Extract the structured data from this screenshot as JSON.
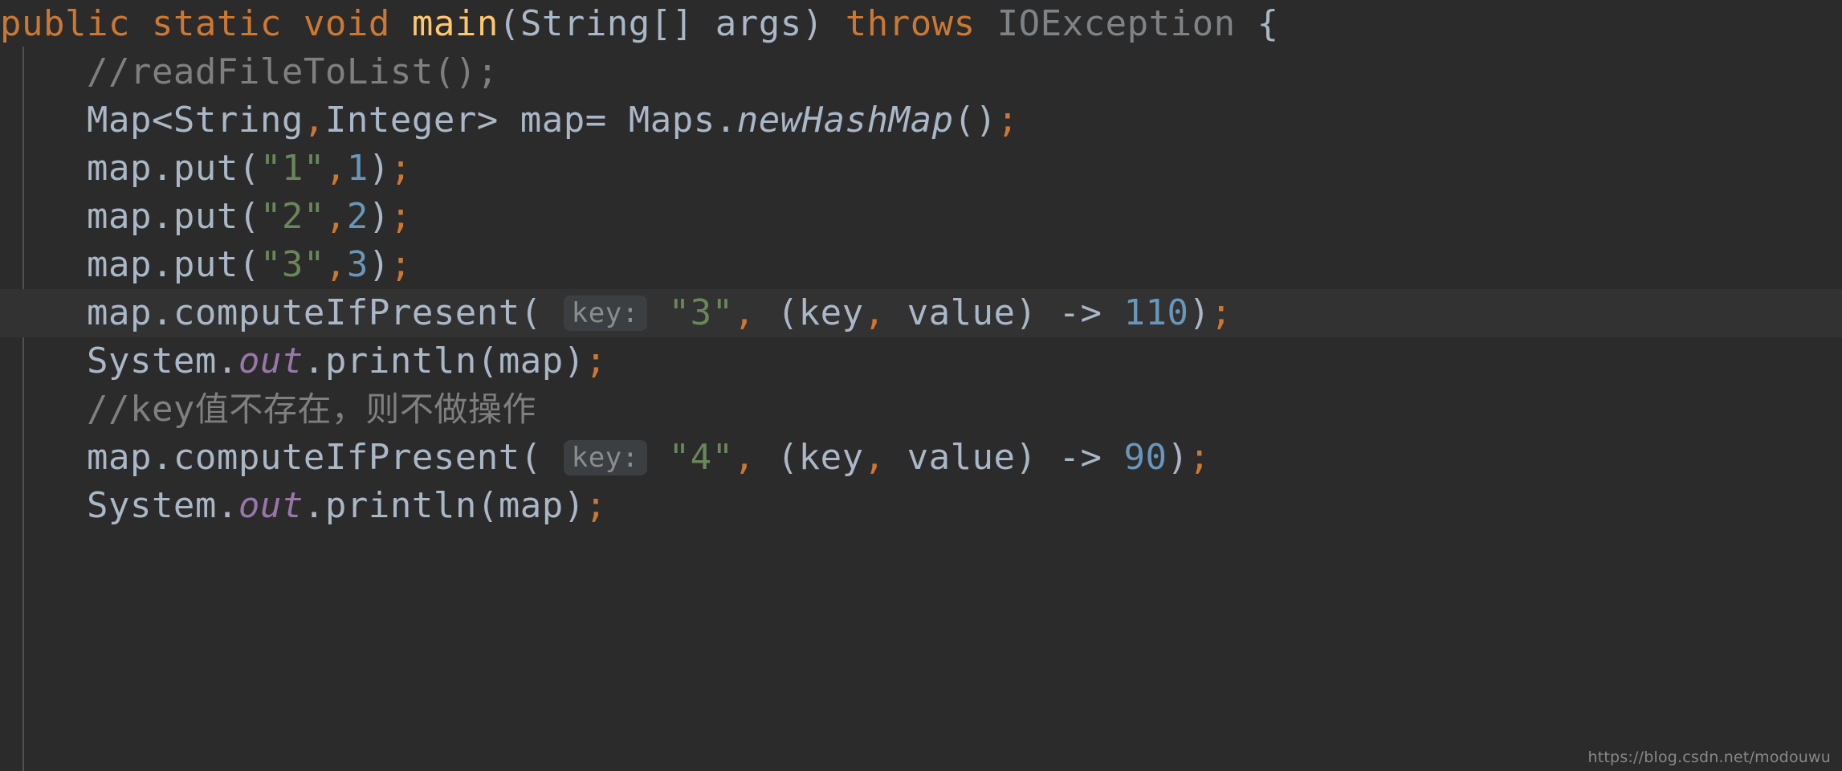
{
  "editor": {
    "theme_name": "Darcula",
    "language": "Java",
    "background_color": "#2b2b2b",
    "caret_line_color": "#323232",
    "guide_line_color": "#4f5050",
    "font_size_px": 44,
    "line_height_px": 60,
    "colors": {
      "keyword": "#cc7832",
      "method_declaration": "#ffc66d",
      "identifier": "#a9b7c6",
      "dimmed_type": "#7f8386",
      "string": "#6a8759",
      "number": "#6897bb",
      "comment": "#7f7f7f",
      "static_field": "#9876aa",
      "param_hint_bg": "#3c3f41",
      "param_hint_fg": "#8c8c8c"
    }
  },
  "lines": [
    {
      "index": 1,
      "indent": 0,
      "caret": false,
      "plain": "public static void main(String[] args) throws IOException {",
      "tokens": [
        {
          "text": "public",
          "type": "keyword"
        },
        {
          "text": " ",
          "type": "plain"
        },
        {
          "text": "static",
          "type": "keyword"
        },
        {
          "text": " ",
          "type": "plain"
        },
        {
          "text": "void",
          "type": "keyword"
        },
        {
          "text": " ",
          "type": "plain"
        },
        {
          "text": "main",
          "type": "method"
        },
        {
          "text": "(",
          "type": "punct"
        },
        {
          "text": "String",
          "type": "ident"
        },
        {
          "text": "[] args) ",
          "type": "ident"
        },
        {
          "text": "throws",
          "type": "keyword"
        },
        {
          "text": " ",
          "type": "plain"
        },
        {
          "text": "IOException",
          "type": "dim"
        },
        {
          "text": " {",
          "type": "punct"
        }
      ]
    },
    {
      "index": 2,
      "indent": 1,
      "caret": false,
      "plain": "//readFileToList();",
      "tokens": [
        {
          "text": "//readFileToList();",
          "type": "comment"
        }
      ]
    },
    {
      "index": 3,
      "indent": 1,
      "caret": false,
      "plain": "Map<String,Integer> map= Maps.newHashMap();",
      "tokens": [
        {
          "text": "Map<String",
          "type": "ident"
        },
        {
          "text": ",",
          "type": "comma"
        },
        {
          "text": "Integer> map= Maps",
          "type": "ident"
        },
        {
          "text": ".",
          "type": "punct"
        },
        {
          "text": "newHashMap",
          "type": "italic"
        },
        {
          "text": "()",
          "type": "punct"
        },
        {
          "text": ";",
          "type": "semi"
        }
      ]
    },
    {
      "index": 4,
      "indent": 1,
      "caret": false,
      "plain": "map.put(\"1\",1);",
      "tokens": [
        {
          "text": "map.put(",
          "type": "ident"
        },
        {
          "text": "\"1\"",
          "type": "string"
        },
        {
          "text": ",",
          "type": "comma"
        },
        {
          "text": "1",
          "type": "number"
        },
        {
          "text": ")",
          "type": "punct"
        },
        {
          "text": ";",
          "type": "semi"
        }
      ]
    },
    {
      "index": 5,
      "indent": 1,
      "caret": false,
      "plain": "map.put(\"2\",2);",
      "tokens": [
        {
          "text": "map.put(",
          "type": "ident"
        },
        {
          "text": "\"2\"",
          "type": "string"
        },
        {
          "text": ",",
          "type": "comma"
        },
        {
          "text": "2",
          "type": "number"
        },
        {
          "text": ")",
          "type": "punct"
        },
        {
          "text": ";",
          "type": "semi"
        }
      ]
    },
    {
      "index": 6,
      "indent": 1,
      "caret": false,
      "plain": "map.put(\"3\",3);",
      "tokens": [
        {
          "text": "map.put(",
          "type": "ident"
        },
        {
          "text": "\"3\"",
          "type": "string"
        },
        {
          "text": ",",
          "type": "comma"
        },
        {
          "text": "3",
          "type": "number"
        },
        {
          "text": ")",
          "type": "punct"
        },
        {
          "text": ";",
          "type": "semi"
        }
      ]
    },
    {
      "index": 7,
      "indent": 1,
      "caret": true,
      "plain": "map.computeIfPresent( key: \"3\", (key, value) -> 110);",
      "hint": "key:",
      "tokens": [
        {
          "text": "map.computeIfPresent(",
          "type": "ident"
        },
        {
          "text": " ",
          "type": "plain"
        },
        {
          "text": "key:",
          "type": "hint"
        },
        {
          "text": " ",
          "type": "plain"
        },
        {
          "text": "\"3\"",
          "type": "string"
        },
        {
          "text": ",",
          "type": "comma"
        },
        {
          "text": " (key",
          "type": "ident"
        },
        {
          "text": ",",
          "type": "comma"
        },
        {
          "text": " value) -> ",
          "type": "ident"
        },
        {
          "text": "110",
          "type": "number"
        },
        {
          "text": ")",
          "type": "punct"
        },
        {
          "text": ";",
          "type": "semi"
        }
      ]
    },
    {
      "index": 8,
      "indent": 1,
      "caret": false,
      "plain": "System.out.println(map);",
      "tokens": [
        {
          "text": "System",
          "type": "ident"
        },
        {
          "text": ".",
          "type": "punct"
        },
        {
          "text": "out",
          "type": "static"
        },
        {
          "text": ".println(map)",
          "type": "ident"
        },
        {
          "text": ";",
          "type": "semi"
        }
      ]
    },
    {
      "index": 9,
      "indent": 1,
      "caret": false,
      "plain": "//key值不存在，则不做操作",
      "tokens": [
        {
          "text": "//key",
          "type": "comment"
        },
        {
          "text": "值不存在，则不做操作",
          "type": "comment-cjk"
        }
      ]
    },
    {
      "index": 10,
      "indent": 1,
      "caret": false,
      "plain": "map.computeIfPresent( key: \"4\", (key, value) -> 90);",
      "hint": "key:",
      "tokens": [
        {
          "text": "map.computeIfPresent(",
          "type": "ident"
        },
        {
          "text": " ",
          "type": "plain"
        },
        {
          "text": "key:",
          "type": "hint"
        },
        {
          "text": " ",
          "type": "plain"
        },
        {
          "text": "\"4\"",
          "type": "string"
        },
        {
          "text": ",",
          "type": "comma"
        },
        {
          "text": " (key",
          "type": "ident"
        },
        {
          "text": ",",
          "type": "comma"
        },
        {
          "text": " value) -> ",
          "type": "ident"
        },
        {
          "text": "90",
          "type": "number"
        },
        {
          "text": ")",
          "type": "punct"
        },
        {
          "text": ";",
          "type": "semi"
        }
      ]
    },
    {
      "index": 11,
      "indent": 1,
      "caret": false,
      "plain": "System.out.println(map);",
      "tokens": [
        {
          "text": "System",
          "type": "ident"
        },
        {
          "text": ".",
          "type": "punct"
        },
        {
          "text": "out",
          "type": "static"
        },
        {
          "text": ".println(map)",
          "type": "ident"
        },
        {
          "text": ";",
          "type": "semi"
        }
      ]
    }
  ],
  "watermark": {
    "text": "https://blog.csdn.net/modouwu"
  }
}
